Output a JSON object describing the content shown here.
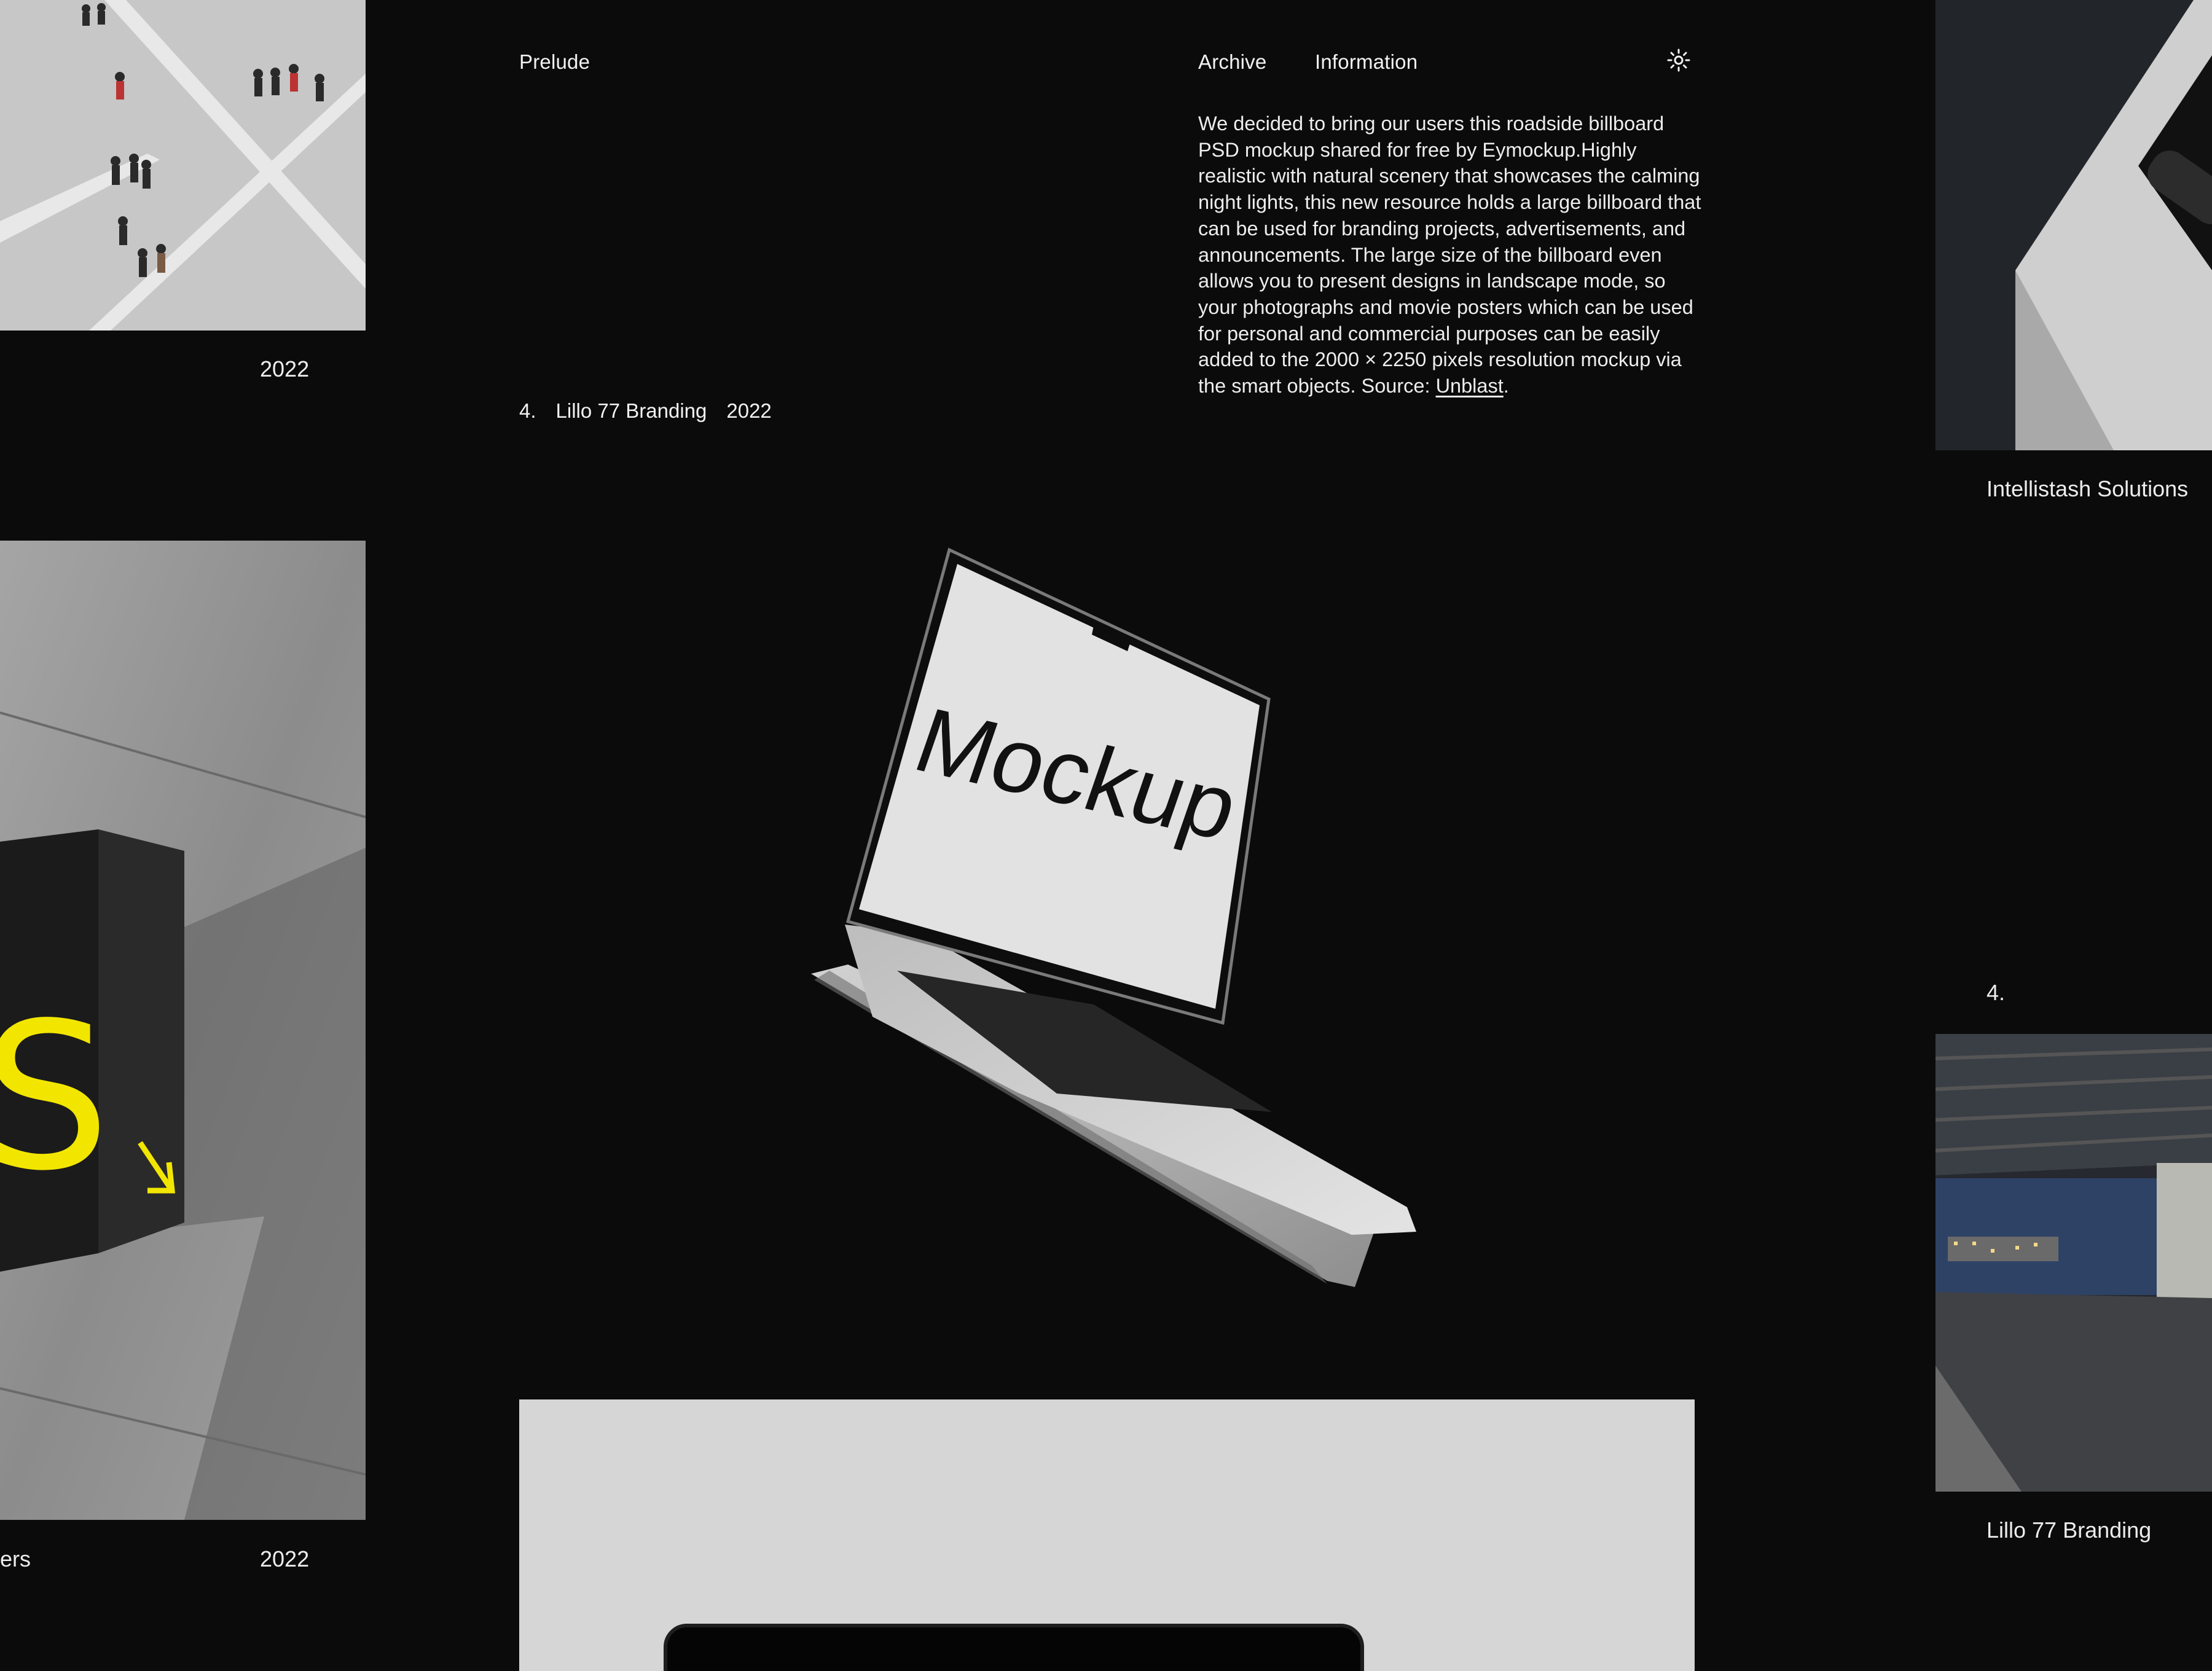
{
  "header": {
    "brand": "Prelude",
    "nav": [
      "Archive",
      "Information"
    ],
    "theme_icon": "sun-icon"
  },
  "description": {
    "text": "We decided to bring our users this roadside billboard PSD mockup shared for free by Eymockup.Highly realistic with natural scenery that showcases the calming night lights, this new resource holds a large billboard that can be used for branding projects, advertisements, and announcements. The large size of the billboard even allows you to present designs in landscape mode, so your photographs and movie posters which can be used for personal and commercial purposes can be easily added to the 2000 × 2250 pixels resolution mockup via the smart objects. Source: ",
    "source_link": "Unblast",
    "tail": "."
  },
  "project": {
    "number": "4.",
    "name": "Lillo 77 Branding",
    "year": "2022"
  },
  "laptop_screen_text": "Mockup",
  "left_column": {
    "items": [
      {
        "caption_left": "",
        "year": "2022"
      },
      {
        "caption_left": "ers",
        "year": "2022"
      }
    ]
  },
  "right_column": {
    "items": [
      {
        "title": "Intellistash Solutions"
      },
      {
        "number": "4.",
        "title": "Lillo 77 Branding"
      }
    ]
  },
  "colors": {
    "background": "#0b0b0c",
    "text": "#efefef",
    "accent_yellow": "#f2e600",
    "card_grey": "#d6d6d6"
  }
}
